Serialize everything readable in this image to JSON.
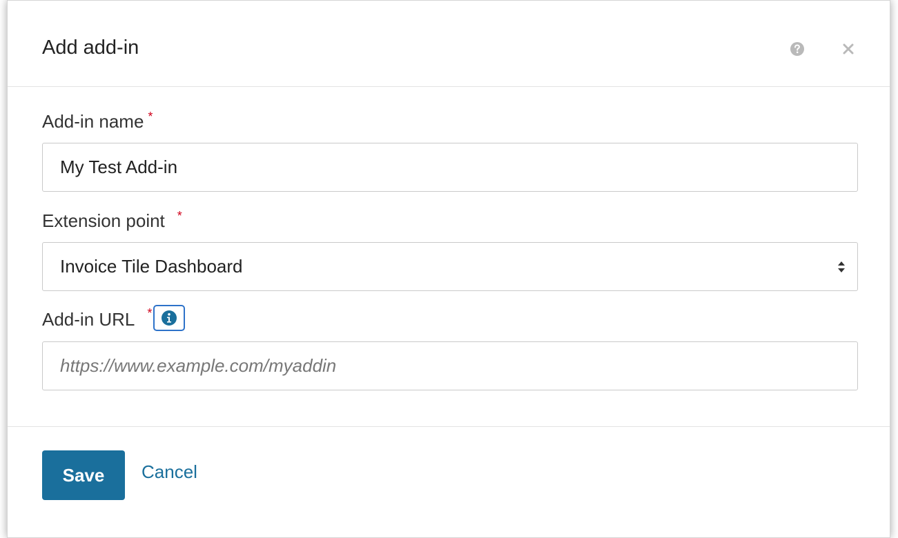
{
  "dialog": {
    "title": "Add add-in",
    "help_icon": "question-circle-icon",
    "close_icon": "close-icon"
  },
  "form": {
    "name_field": {
      "label": "Add-in name",
      "required_mark": "*",
      "value": "My Test Add-in"
    },
    "extension_point": {
      "label": "Extension point",
      "required_mark": "*",
      "selected": "Invoice Tile Dashboard"
    },
    "url_field": {
      "label": "Add-in URL",
      "required_mark": "*",
      "info_icon": "info-circle-icon",
      "value": "",
      "placeholder": "https://www.example.com/myaddin"
    }
  },
  "footer": {
    "save_label": "Save",
    "cancel_label": "Cancel"
  },
  "colors": {
    "primary": "#1a6f9c",
    "required": "#d0021b",
    "info_border": "#2d72c9"
  }
}
